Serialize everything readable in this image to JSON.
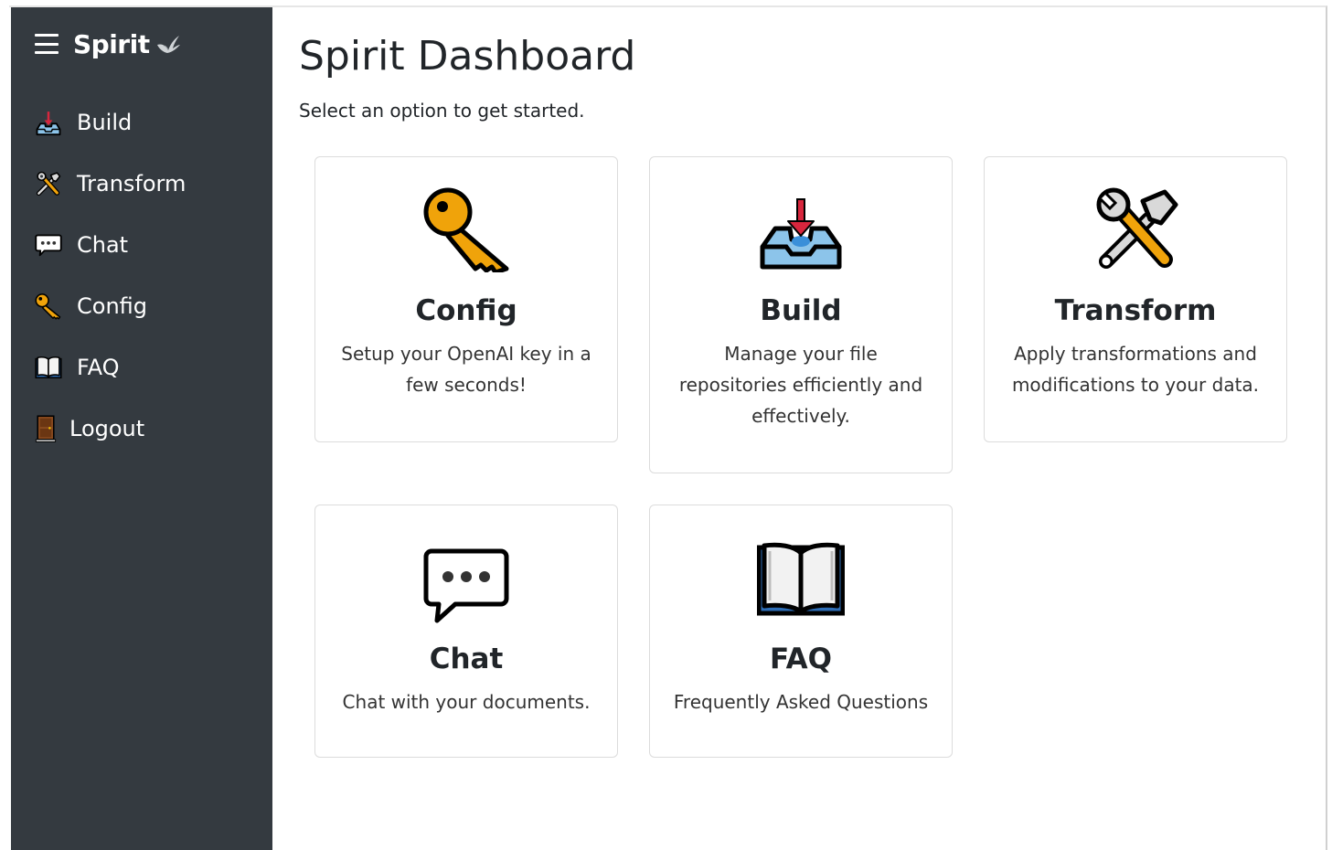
{
  "sidebar": {
    "brand": "Spirit",
    "items": [
      {
        "label": "Build",
        "icon": "inbox-tray-icon"
      },
      {
        "label": "Transform",
        "icon": "hammer-and-wrench-icon"
      },
      {
        "label": "Chat",
        "icon": "speech-balloon-icon"
      },
      {
        "label": "Config",
        "icon": "key-icon"
      },
      {
        "label": "FAQ",
        "icon": "open-book-icon"
      },
      {
        "label": "Logout",
        "icon": "door-icon"
      }
    ]
  },
  "main": {
    "title": "Spirit Dashboard",
    "subtitle": "Select an option to get started.",
    "cards": [
      {
        "title": "Config",
        "text": "Setup your OpenAI key in a few seconds!",
        "icon": "key-icon"
      },
      {
        "title": "Build",
        "text": "Manage your file repositories efficiently and effectively.",
        "icon": "inbox-tray-icon"
      },
      {
        "title": "Transform",
        "text": "Apply transformations and modifications to your data.",
        "icon": "hammer-and-wrench-icon"
      },
      {
        "title": "Chat",
        "text": "Chat with your documents.",
        "icon": "speech-balloon-icon"
      },
      {
        "title": "FAQ",
        "text": "Frequently Asked Questions",
        "icon": "open-book-icon"
      }
    ]
  },
  "colors": {
    "sidebar_bg": "#343a40",
    "key_gold": "#f0a30a",
    "tray_blue": "#8cc4ea",
    "arrow_red": "#d7263d"
  }
}
